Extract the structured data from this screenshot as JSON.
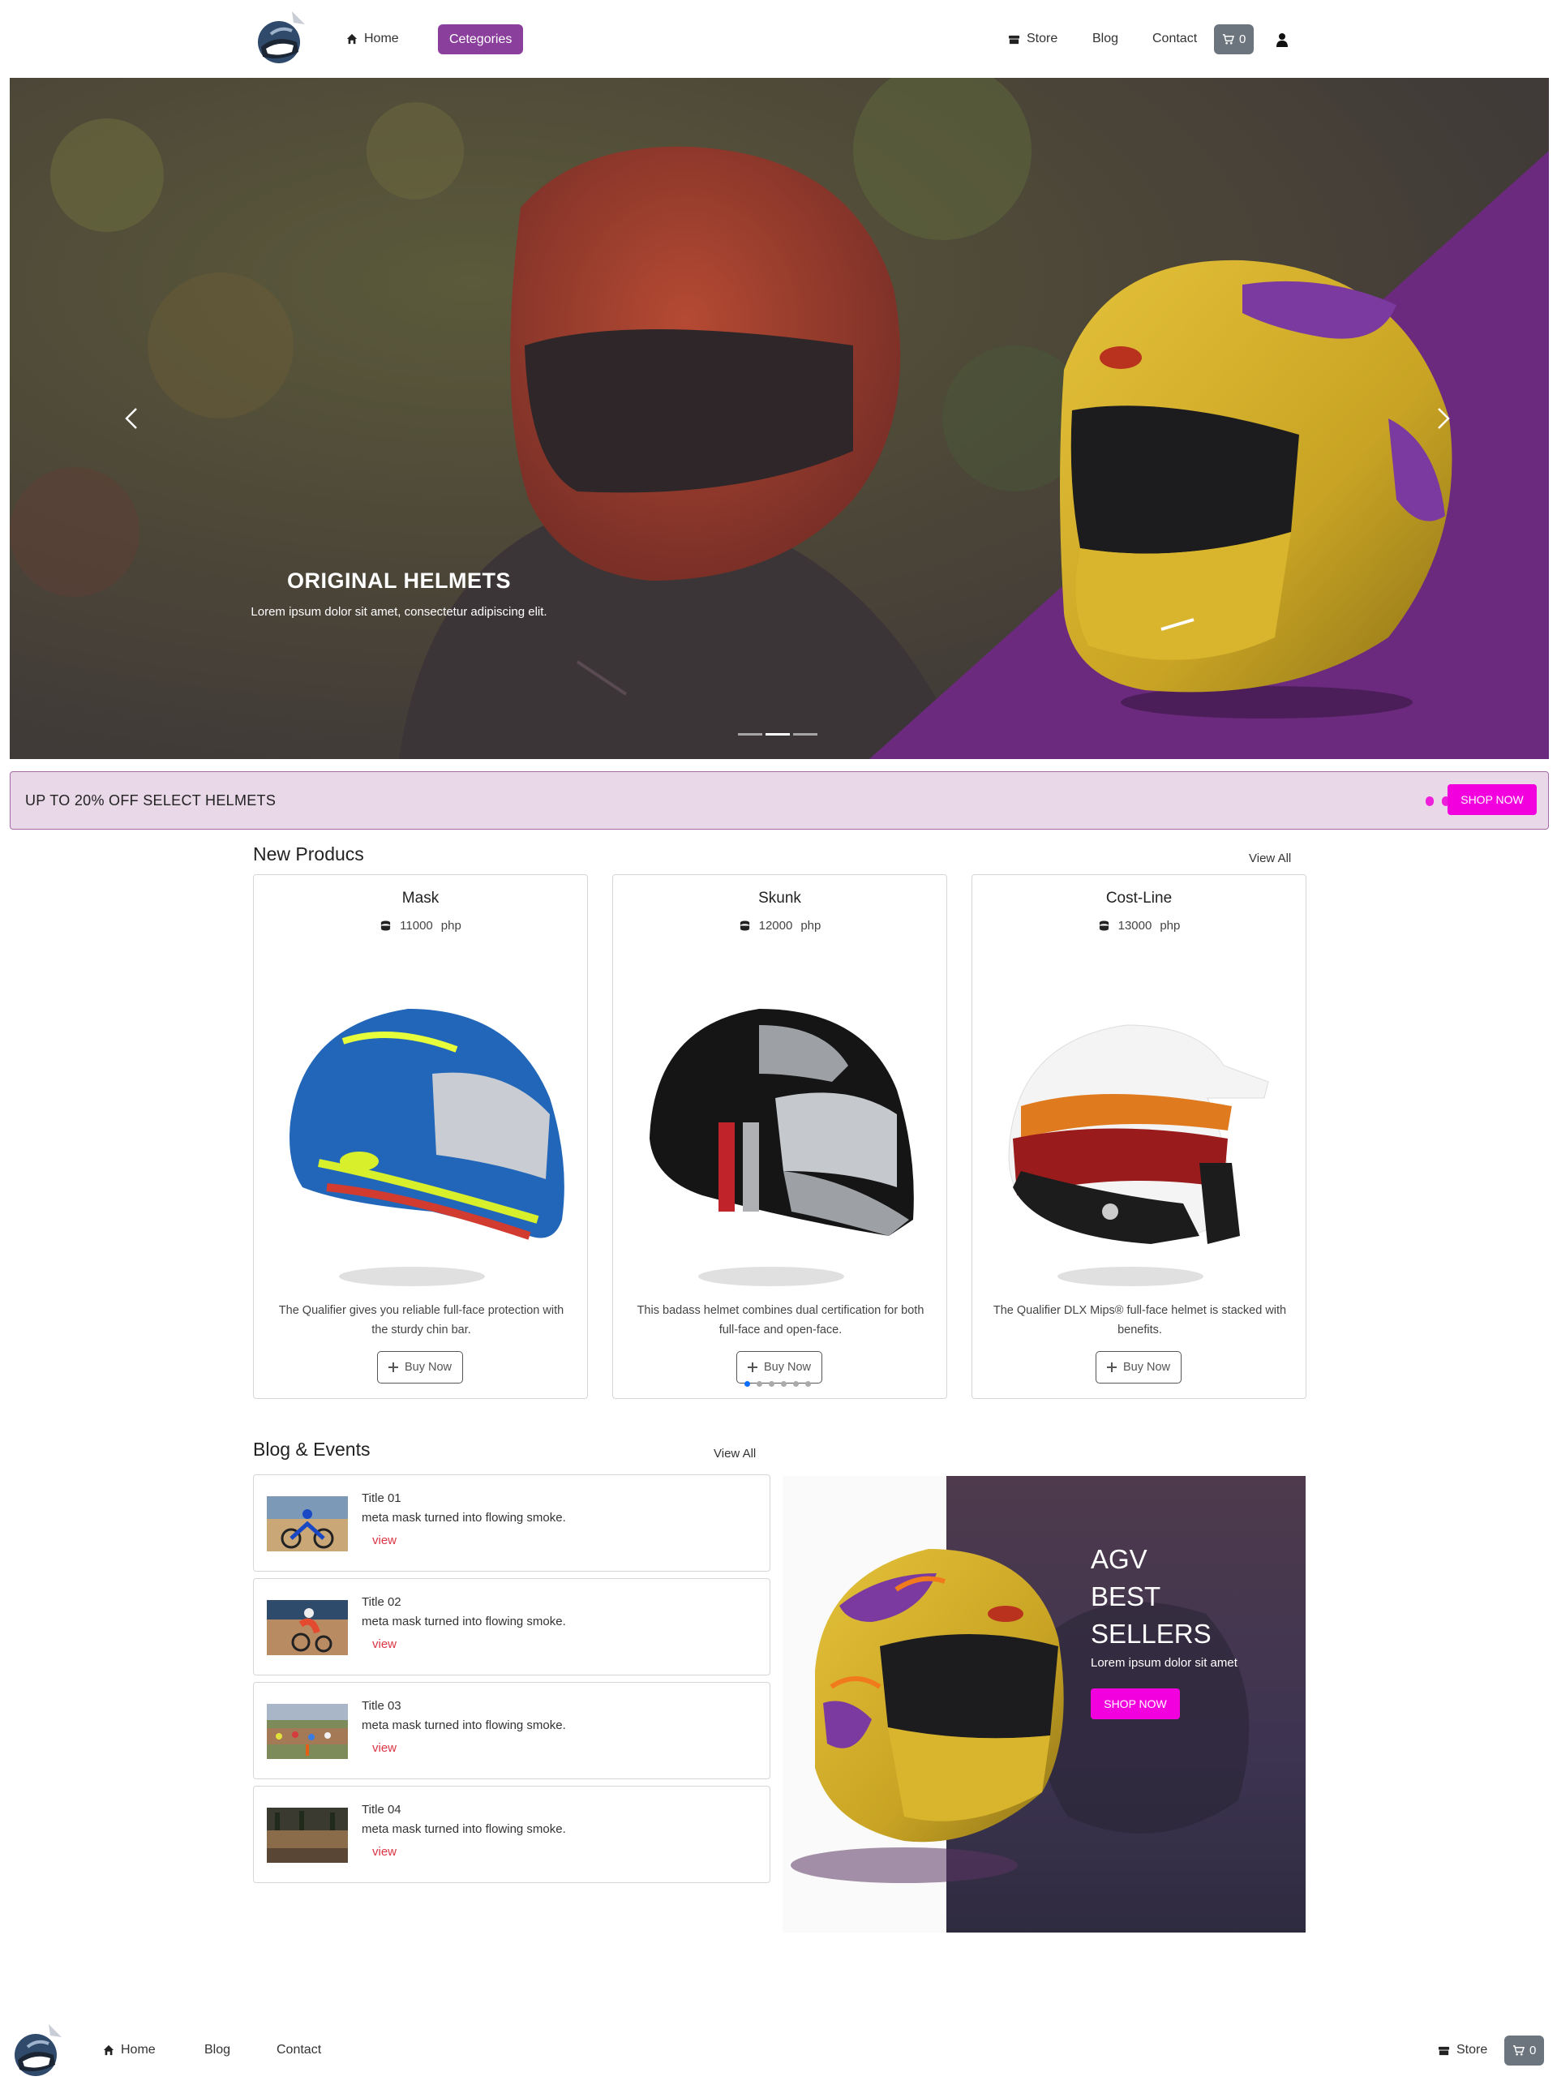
{
  "nav": {
    "home": "Home",
    "categories": "Cetegories",
    "store": "Store",
    "blog": "Blog",
    "contact": "Contact",
    "cart_count": "0"
  },
  "hero": {
    "title": "ORIGINAL HELMETS",
    "subtitle": "Lorem ipsum dolor sit amet, consectetur adipiscing elit.",
    "slides": 3,
    "active_slide": 2,
    "accent_color": "#6b2a7e"
  },
  "promo": {
    "text": "UP TO 20% OFF SELECT HELMETS",
    "button": "SHOP NOW",
    "button_color": "#f200de"
  },
  "products": {
    "title": "New Producs",
    "view_all": "View All",
    "items": [
      {
        "name": "Mask",
        "price": "11000",
        "currency": "php",
        "description": "The Qualifier gives you reliable full-face protection with the sturdy chin bar.",
        "button": "Buy Now",
        "icon": "plus-icon"
      },
      {
        "name": "Skunk",
        "price": "12000",
        "currency": "php",
        "description": "This badass helmet combines dual certification for both full-face and open-face.",
        "button": "Buy Now",
        "icon": "plus-icon"
      },
      {
        "name": "Cost-Line",
        "price": "13000",
        "currency": "php",
        "description": "The Qualifier DLX Mips® full-face helmet is stacked with benefits.",
        "button": "Buy Now",
        "icon": "plus-icon"
      }
    ]
  },
  "blog": {
    "title": "Blog & Events",
    "view_all": "View All",
    "items": [
      {
        "title": "Title 01",
        "desc": "meta mask turned into flowing smoke.",
        "link": "view"
      },
      {
        "title": "Title 02",
        "desc": "meta mask turned into flowing smoke.",
        "link": "view"
      },
      {
        "title": "Title 03",
        "desc": "meta mask turned into flowing smoke.",
        "link": "view"
      },
      {
        "title": "Title 04",
        "desc": "meta mask turned into flowing smoke.",
        "link": "view"
      }
    ]
  },
  "agv": {
    "line1": "AGV",
    "line2": "BEST",
    "line3": "SELLERS",
    "subtitle": "Lorem ipsum dolor sit amet",
    "button": "SHOP NOW"
  },
  "footer": {
    "home": "Home",
    "blog": "Blog",
    "contact": "Contact",
    "store": "Store",
    "cart_count": "0"
  }
}
